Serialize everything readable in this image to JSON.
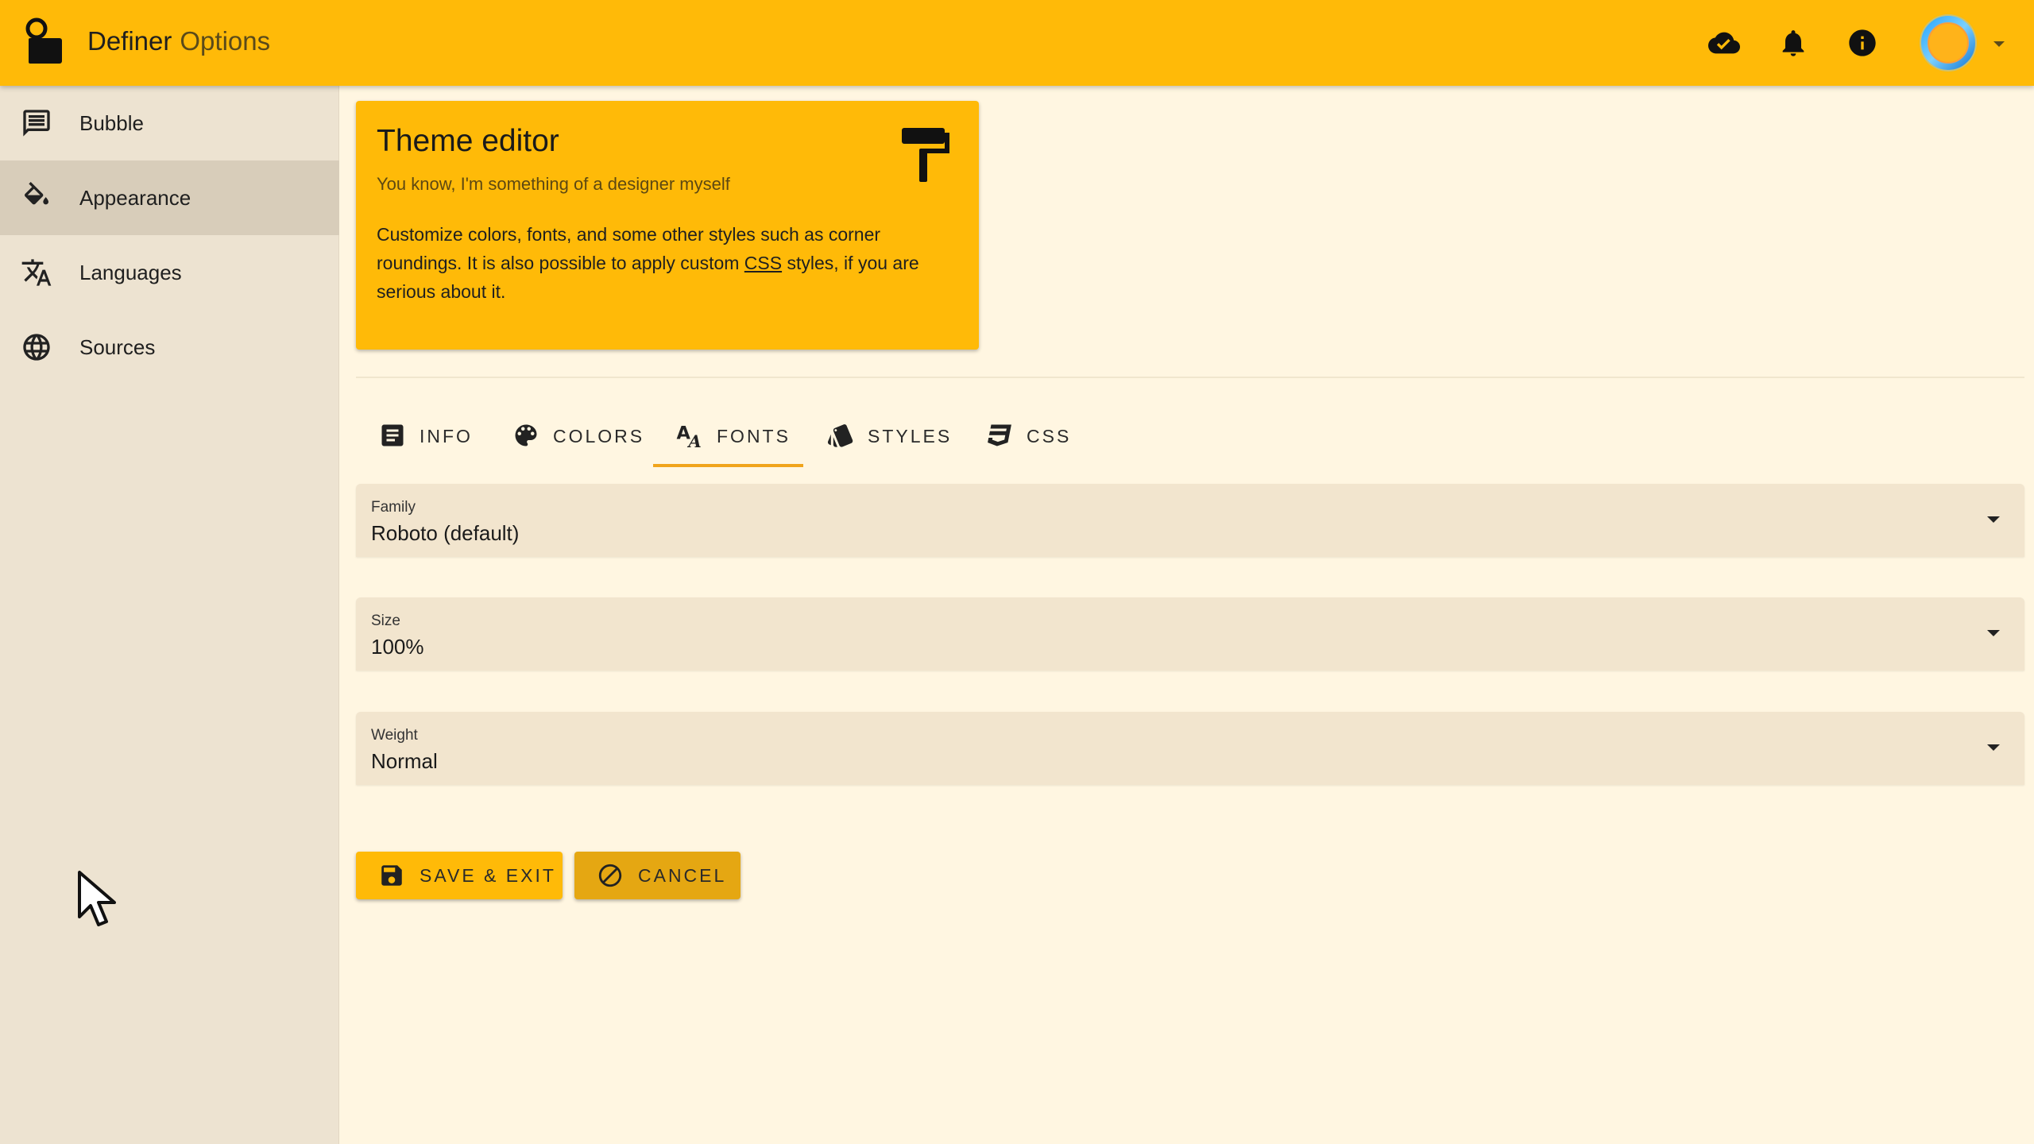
{
  "app": {
    "name": "Definer",
    "subtitle": "Options"
  },
  "appbar": {
    "icons": [
      "cloud-done-icon",
      "bell-icon",
      "info-icon"
    ],
    "avatar": "user-avatar"
  },
  "sidebar": {
    "items": [
      {
        "label": "Bubble",
        "icon": "chat-icon",
        "active": false
      },
      {
        "label": "Appearance",
        "icon": "paint-bucket-icon",
        "active": true
      },
      {
        "label": "Languages",
        "icon": "translate-icon",
        "active": false
      },
      {
        "label": "Sources",
        "icon": "globe-icon",
        "active": false
      }
    ]
  },
  "theme_card": {
    "title": "Theme editor",
    "subtitle": "You know, I'm something of a designer myself",
    "body_before_link": "Customize colors, fonts, and some other styles such as corner roundings. It is also possible to apply custom ",
    "link_text": "CSS",
    "body_after_link": " styles, if you are serious about it.",
    "icon": "paint-roller-icon"
  },
  "tabs": [
    {
      "label": "INFO",
      "icon": "article-icon",
      "active": false
    },
    {
      "label": "COLORS",
      "icon": "palette-icon",
      "active": false
    },
    {
      "label": "FONTS",
      "icon": "font-icon",
      "active": true
    },
    {
      "label": "STYLES",
      "icon": "style-icon",
      "active": false
    },
    {
      "label": "CSS",
      "icon": "css-icon",
      "active": false
    }
  ],
  "fields": {
    "family": {
      "label": "Family",
      "value": "Roboto (default)"
    },
    "size": {
      "label": "Size",
      "value": "100%"
    },
    "weight": {
      "label": "Weight",
      "value": "Normal"
    }
  },
  "buttons": {
    "save_label": "SAVE & EXIT",
    "cancel_label": "CANCEL"
  },
  "colors": {
    "primary": "#FFBA08",
    "background": "#FFF6E1",
    "sidebar": "#EDE3D1",
    "sidebar_active": "#D8CDBA",
    "tab_indicator": "#F0A41B",
    "cancel_button": "#E5A712"
  }
}
